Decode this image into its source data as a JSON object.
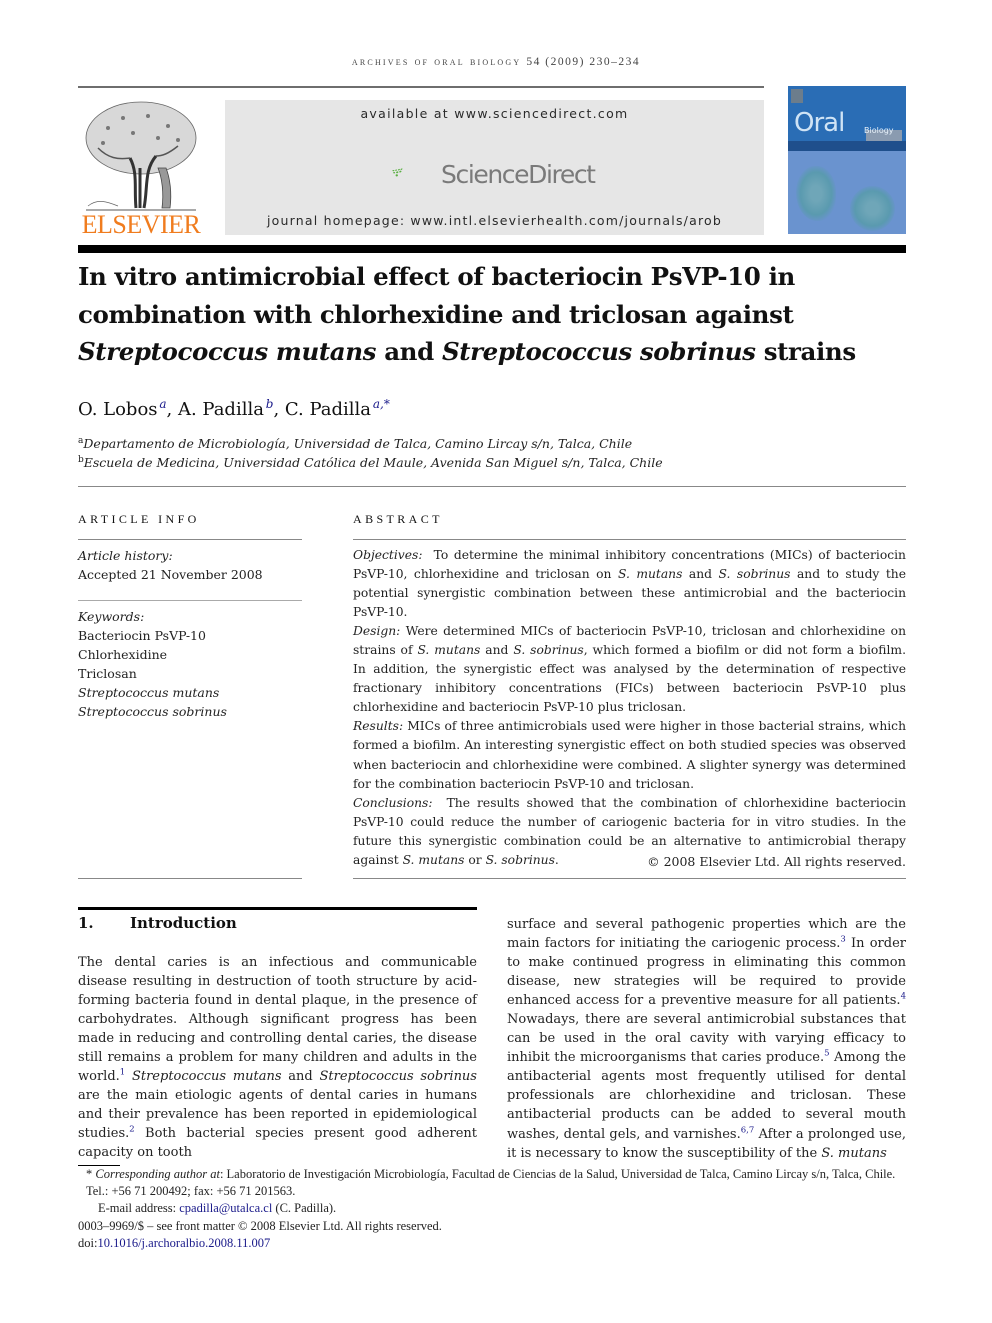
{
  "running_head": {
    "journal": "Archives of Oral Biology",
    "volume_year_pages": "54 (2009) 230–234"
  },
  "banner": {
    "available": "available at www.sciencedirect.com",
    "sciencedirect_logo": "ScienceDirect",
    "homepage": "journal homepage: www.intl.elsevierhealth.com/journals/arob"
  },
  "publisher_logo": "ELSEVIER",
  "cover": {
    "title_main": "Oral",
    "title_sub": "Biology"
  },
  "title": {
    "line1": "In vitro antimicrobial effect of bacteriocin PsVP-10 in",
    "line2": "combination with chlorhexidine and triclosan against",
    "line3_species1": "Streptococcus mutans",
    "line3_and": " and ",
    "line3_species2": "Streptococcus sobrinus",
    "line3_tail": " strains"
  },
  "authors": [
    {
      "name": "O. Lobos",
      "sup": "a"
    },
    {
      "name": "A. Padilla",
      "sup": "b"
    },
    {
      "name": "C. Padilla",
      "sup": "a,*"
    }
  ],
  "affiliations": [
    {
      "key": "a",
      "text": "Departamento de Microbiología, Universidad de Talca, Camino Lircay s/n, Talca, Chile"
    },
    {
      "key": "b",
      "text": "Escuela de Medicina, Universidad Católica del Maule, Avenida San Miguel s/n, Talca, Chile"
    }
  ],
  "article_info": {
    "heading": "ARTICLE INFO",
    "history_label": "Article history:",
    "accepted": "Accepted 21 November 2008",
    "keywords_label": "Keywords:",
    "keywords": [
      "Bacteriocin PsVP-10",
      "Chlorhexidine",
      "Triclosan",
      "Streptococcus mutans",
      "Streptococcus sobrinus"
    ]
  },
  "abstract": {
    "heading": "ABSTRACT",
    "objectives_label": "Objectives:",
    "objectives_1": "To determine the minimal inhibitory concentrations (MICs) of bacteriocin PsVP-10, chlorhexidine and triclosan on ",
    "objectives_sm": "S. mutans",
    "objectives_2": " and ",
    "objectives_ss": "S. sobrinus",
    "objectives_3": " and to study the potential synergistic combination between these antimicrobial and the bacteriocin PsVP-10.",
    "design_label": "Design:",
    "design_1": "Were determined MICs of bacteriocin PsVP-10, triclosan and chlorhexidine on strains of ",
    "design_sm": "S. mutans",
    "design_2": " and ",
    "design_ss": "S. sobrinus",
    "design_3": ", which formed a biofilm or did not form a biofilm. In addition, the synergistic effect was analysed by the determination of respective fractionary inhibitory concentrations (FICs) between bacteriocin PsVP-10 plus chlorhexidine and bacteriocin PsVP-10 plus triclosan.",
    "results_label": "Results:",
    "results": "MICs of three antimicrobials used were higher in those bacterial strains, which formed a biofilm. An interesting synergistic effect on both studied species was observed when bacteriocin and chlorhexidine were combined. A slighter synergy was determined for the combination bacteriocin PsVP-10 and triclosan.",
    "conclusions_label": "Conclusions:",
    "conclusions_1": "The results showed that the combination of chlorhexidine bacteriocin PsVP-10 could reduce the number of cariogenic bacteria for in vitro studies. In the future this synergistic combination could be an alternative to antimicrobial therapy against ",
    "conclusions_sm": "S. mutans",
    "conclusions_2": " or ",
    "conclusions_ss": "S. sobrinus",
    "conclusions_3": ".",
    "copyright": "© 2008 Elsevier Ltd. All rights reserved."
  },
  "introduction": {
    "number": "1.",
    "heading": "Introduction",
    "left_1": "The dental caries is an infectious and communicable disease resulting in destruction of tooth structure by acid-forming bacteria found in dental plaque, in the presence of carbohydrates. Although significant progress has been made in reducing and controlling dental caries, the disease still remains a problem for many children and adults in the world.",
    "ref1": "1",
    "left_sm": "Streptococcus mutans",
    "left_and": " and ",
    "left_ss": "Streptococcus sobrinus",
    "left_2": " are the main etiologic agents of dental caries in humans and their prevalence has been reported in epidemiological studies.",
    "ref2": "2",
    "left_3": " Both bacterial species present good adherent capacity on tooth",
    "right_1": "surface and several pathogenic properties which are the main factors for initiating the cariogenic process.",
    "ref3": "3",
    "right_2": " In order to make continued progress in eliminating this common disease, new strategies will be required to provide enhanced access for a preventive measure for all patients.",
    "ref4": "4",
    "right_3": " Nowadays, there are several antimicrobial substances that can be used in the oral cavity with varying efficacy to inhibit the microorganisms that caries produce.",
    "ref5": "5",
    "right_4": " Among the antibacterial agents most frequently utilised for dental professionals are chlorhexidine and triclosan. These antibacterial products can be added to several mouth washes, dental gels, and varnishes.",
    "ref67": "6,7",
    "right_5": " After a prolonged use, it is necessary to know the susceptibility of the ",
    "right_sm": "S. mutans"
  },
  "footnotes": {
    "corr_star": "*",
    "corr_label": "Corresponding author at",
    "corr_text": ": Laboratorio de Investigación Microbiología, Facultad de Ciencias de la Salud, Universidad de Talca, Camino Lircay s/n, Talca, Chile. Tel.: +56 71 200492; fax: +56 71 201563.",
    "email_label": "E-mail address: ",
    "email": "cpadilla@utalca.cl",
    "email_name": " (C. Padilla).",
    "issn": "0003–9969/$ – see front matter © 2008 Elsevier Ltd. All rights reserved.",
    "doi_label": "doi:",
    "doi": "10.1016/j.archoralbio.2008.11.007"
  }
}
